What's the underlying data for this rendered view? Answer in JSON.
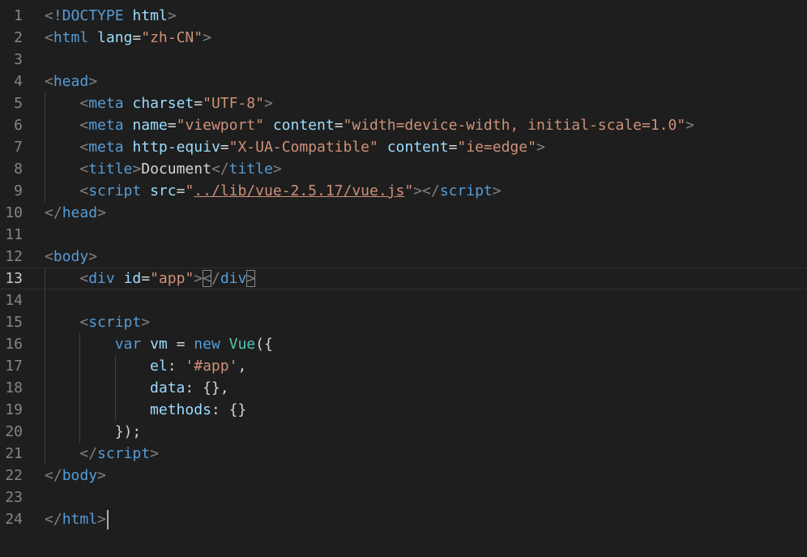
{
  "editor": {
    "language": "html",
    "current_line": 13,
    "lines": [
      {
        "n": "1",
        "indent": 0,
        "tokens": [
          [
            "punc",
            "<"
          ],
          [
            "tag",
            "!DOCTYPE"
          ],
          [
            "text",
            " "
          ],
          [
            "attr",
            "html"
          ],
          [
            "punc",
            ">"
          ]
        ]
      },
      {
        "n": "2",
        "indent": 0,
        "tokens": [
          [
            "punc",
            "<"
          ],
          [
            "tag",
            "html"
          ],
          [
            "text",
            " "
          ],
          [
            "attr",
            "lang"
          ],
          [
            "text",
            "="
          ],
          [
            "str",
            "\"zh-CN\""
          ],
          [
            "punc",
            ">"
          ]
        ]
      },
      {
        "n": "3",
        "indent": 0,
        "tokens": []
      },
      {
        "n": "4",
        "indent": 0,
        "tokens": [
          [
            "punc",
            "<"
          ],
          [
            "tag",
            "head"
          ],
          [
            "punc",
            ">"
          ]
        ]
      },
      {
        "n": "5",
        "indent": 1,
        "tokens": [
          [
            "punc",
            "<"
          ],
          [
            "tag",
            "meta"
          ],
          [
            "text",
            " "
          ],
          [
            "attr",
            "charset"
          ],
          [
            "text",
            "="
          ],
          [
            "str",
            "\"UTF-8\""
          ],
          [
            "punc",
            ">"
          ]
        ]
      },
      {
        "n": "6",
        "indent": 1,
        "tokens": [
          [
            "punc",
            "<"
          ],
          [
            "tag",
            "meta"
          ],
          [
            "text",
            " "
          ],
          [
            "attr",
            "name"
          ],
          [
            "text",
            "="
          ],
          [
            "str",
            "\"viewport\""
          ],
          [
            "text",
            " "
          ],
          [
            "attr",
            "content"
          ],
          [
            "text",
            "="
          ],
          [
            "str",
            "\"width=device-width, initial-scale=1.0\""
          ],
          [
            "punc",
            ">"
          ]
        ]
      },
      {
        "n": "7",
        "indent": 1,
        "tokens": [
          [
            "punc",
            "<"
          ],
          [
            "tag",
            "meta"
          ],
          [
            "text",
            " "
          ],
          [
            "attr",
            "http-equiv"
          ],
          [
            "text",
            "="
          ],
          [
            "str",
            "\"X-UA-Compatible\""
          ],
          [
            "text",
            " "
          ],
          [
            "attr",
            "content"
          ],
          [
            "text",
            "="
          ],
          [
            "str",
            "\"ie=edge\""
          ],
          [
            "punc",
            ">"
          ]
        ]
      },
      {
        "n": "8",
        "indent": 1,
        "tokens": [
          [
            "punc",
            "<"
          ],
          [
            "tag",
            "title"
          ],
          [
            "punc",
            ">"
          ],
          [
            "text",
            "Document"
          ],
          [
            "punc",
            "</"
          ],
          [
            "tag",
            "title"
          ],
          [
            "punc",
            ">"
          ]
        ]
      },
      {
        "n": "9",
        "indent": 1,
        "tokens": [
          [
            "punc",
            "<"
          ],
          [
            "tag",
            "script"
          ],
          [
            "text",
            " "
          ],
          [
            "attr",
            "src"
          ],
          [
            "text",
            "="
          ],
          [
            "str",
            "\""
          ],
          [
            "link",
            "../lib/vue-2.5.17/vue.js"
          ],
          [
            "str",
            "\""
          ],
          [
            "punc",
            "></"
          ],
          [
            "tag",
            "script"
          ],
          [
            "punc",
            ">"
          ]
        ]
      },
      {
        "n": "10",
        "indent": 0,
        "tokens": [
          [
            "punc",
            "</"
          ],
          [
            "tag",
            "head"
          ],
          [
            "punc",
            ">"
          ]
        ]
      },
      {
        "n": "11",
        "indent": 0,
        "tokens": []
      },
      {
        "n": "12",
        "indent": 0,
        "tokens": [
          [
            "punc",
            "<"
          ],
          [
            "tag",
            "body"
          ],
          [
            "punc",
            ">"
          ]
        ]
      },
      {
        "n": "13",
        "indent": 1,
        "tokens": [
          [
            "punc",
            "<"
          ],
          [
            "tag",
            "div"
          ],
          [
            "text",
            " "
          ],
          [
            "attr",
            "id"
          ],
          [
            "text",
            "="
          ],
          [
            "str",
            "\"app\""
          ],
          [
            "punc",
            ">"
          ],
          [
            "match",
            "<"
          ],
          [
            "punc",
            "/"
          ],
          [
            "tag",
            "div"
          ],
          [
            "match",
            ">"
          ]
        ]
      },
      {
        "n": "14",
        "indent": 0,
        "tokens": []
      },
      {
        "n": "15",
        "indent": 1,
        "tokens": [
          [
            "punc",
            "<"
          ],
          [
            "tag",
            "script"
          ],
          [
            "punc",
            ">"
          ]
        ]
      },
      {
        "n": "16",
        "indent": 2,
        "tokens": [
          [
            "key",
            "var"
          ],
          [
            "text",
            " "
          ],
          [
            "var",
            "vm"
          ],
          [
            "op",
            " = "
          ],
          [
            "key",
            "new"
          ],
          [
            "text",
            " "
          ],
          [
            "cls",
            "Vue"
          ],
          [
            "op",
            "({"
          ]
        ]
      },
      {
        "n": "17",
        "indent": 3,
        "tokens": [
          [
            "var",
            "el"
          ],
          [
            "op",
            ": "
          ],
          [
            "str",
            "'#app'"
          ],
          [
            "op",
            ","
          ]
        ]
      },
      {
        "n": "18",
        "indent": 3,
        "tokens": [
          [
            "var",
            "data"
          ],
          [
            "op",
            ": {},"
          ]
        ]
      },
      {
        "n": "19",
        "indent": 3,
        "tokens": [
          [
            "var",
            "methods"
          ],
          [
            "op",
            ": {}"
          ]
        ]
      },
      {
        "n": "20",
        "indent": 2,
        "tokens": [
          [
            "op",
            "});"
          ]
        ]
      },
      {
        "n": "21",
        "indent": 1,
        "tokens": [
          [
            "punc",
            "</"
          ],
          [
            "tag",
            "script"
          ],
          [
            "punc",
            ">"
          ]
        ]
      },
      {
        "n": "22",
        "indent": 0,
        "tokens": [
          [
            "punc",
            "</"
          ],
          [
            "tag",
            "body"
          ],
          [
            "punc",
            ">"
          ]
        ]
      },
      {
        "n": "23",
        "indent": 0,
        "tokens": []
      },
      {
        "n": "24",
        "indent": 0,
        "tokens": [
          [
            "punc",
            "</"
          ],
          [
            "tag",
            "html"
          ],
          [
            "punc",
            ">"
          ]
        ]
      }
    ]
  },
  "colors": {
    "background": "#1e1e1e",
    "tag": "#569cd6",
    "attribute": "#9cdcfe",
    "string": "#ce9178",
    "punctuation": "#808080",
    "class": "#4ec9b0",
    "line_number": "#858585"
  }
}
